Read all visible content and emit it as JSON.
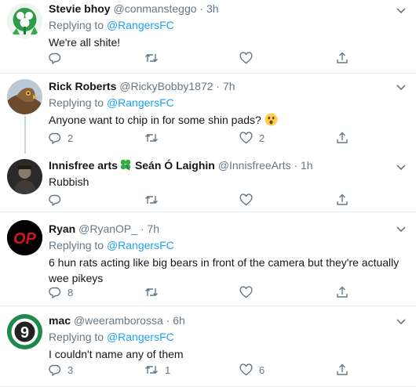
{
  "tweets": [
    {
      "name": "Stevie bhoy",
      "handle": "@conmansteggo",
      "dot": "·",
      "time": "3h",
      "replying_prefix": "Replying to",
      "replying_to": "@RangersFC",
      "text": "We're all shite!",
      "replies": "",
      "retweets": "",
      "likes": ""
    },
    {
      "name": "Rick Roberts",
      "handle": "@RickyBobby1872",
      "dot": "·",
      "time": "7h",
      "replying_prefix": "Replying to",
      "replying_to": "@RangersFC",
      "text": "Anyone want to chip in for some shin pads?",
      "emoji": "astonished-face-emoji",
      "replies": "2",
      "retweets": "",
      "likes": "2"
    },
    {
      "name_part1": "Innisfree arts",
      "name_part2": "Seán Ó Laighin",
      "handle": "@InnisfreeArts",
      "dot": "·",
      "time": "1h",
      "text": "Rubbish",
      "replies": "",
      "retweets": "",
      "likes": ""
    },
    {
      "name": "Ryan",
      "handle": "@RyanOP_",
      "dot": "·",
      "time": "7h",
      "replying_prefix": "Replying to",
      "replying_to": "@RangersFC",
      "text_line1": "6 hun rats acting like big bears in front of the camera but they're actually",
      "text_line2": "wee pikeys",
      "avatar_text": "OP",
      "replies": "8",
      "retweets": "",
      "likes": ""
    },
    {
      "name": "mac",
      "handle": "@weeramborossa",
      "dot": "·",
      "time": "6h",
      "replying_prefix": "Replying to",
      "replying_to": "@RangersFC",
      "text": "I couldn't name any of them",
      "avatar_text": "9",
      "replies": "3",
      "retweets": "1",
      "likes": "6"
    }
  ],
  "icons": {
    "reply": "reply-icon",
    "retweet": "retweet-icon",
    "like": "like-icon",
    "share": "share-icon",
    "more": "chevron-down-icon",
    "clover": "four-leaf-clover-icon"
  },
  "colors": {
    "link": "#1da1f2",
    "secondary": "#657786",
    "divider": "#e6ecf0",
    "thread_line": "#ccd6dd"
  }
}
